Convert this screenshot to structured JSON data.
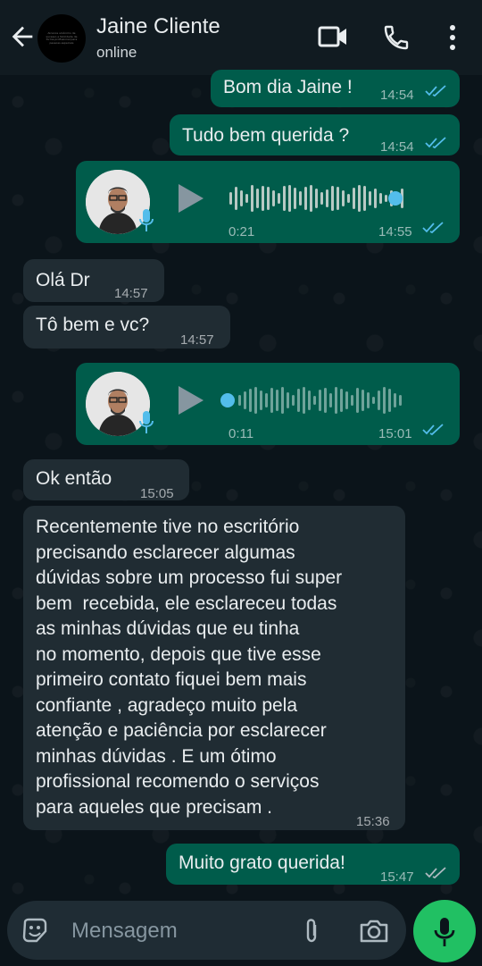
{
  "header": {
    "contact_name": "Jaine Cliente",
    "status": "online",
    "avatar_fineprint": "Alcance sinônimo de sucesso e felicidade de forma profissional para pessoas especiais",
    "icons": [
      "back-arrow-icon",
      "video-call-icon",
      "phone-icon",
      "more-vert-icon"
    ]
  },
  "messages": [
    {
      "type": "text",
      "direction": "out",
      "text": "Bom dia Jaine !",
      "time": "14:54",
      "status": "read"
    },
    {
      "type": "text",
      "direction": "out",
      "text": "Tudo bem querida ?",
      "time": "14:54",
      "status": "read"
    },
    {
      "type": "audio",
      "direction": "out",
      "duration": "0:21",
      "time": "14:55",
      "status": "read",
      "progress": 0.95
    },
    {
      "type": "text",
      "direction": "in",
      "text": "Olá Dr",
      "time": "14:57"
    },
    {
      "type": "text",
      "direction": "in",
      "text": "Tô bem e vc?",
      "time": "14:57"
    },
    {
      "type": "audio",
      "direction": "out",
      "duration": "0:11",
      "time": "15:01",
      "status": "read",
      "progress": 0.0
    },
    {
      "type": "text",
      "direction": "in",
      "text": "Ok então",
      "time": "15:05"
    },
    {
      "type": "text",
      "direction": "in",
      "lines": [
        "Recentemente tive no escritório",
        "precisando esclarecer algumas",
        "dúvidas sobre um processo fui super",
        "bem  recebida, ele esclareceu todas",
        "as minhas dúvidas que eu tinha",
        "no momento, depois que tive esse",
        "primeiro contato fiquei bem mais",
        "confiante , agradeço muito pela",
        "atenção e paciência por esclarecer",
        "minhas dúvidas . E um ótimo",
        "profissional recomendo o serviços",
        "para aqueles que precisam ."
      ],
      "time": "15:36"
    },
    {
      "type": "text",
      "direction": "out",
      "text": "Muito grato querida!",
      "time": "15:47",
      "status": "delivered"
    }
  ],
  "composer": {
    "placeholder": "Mensagem",
    "icons": [
      "emoji-icon",
      "attach-icon",
      "camera-icon",
      "mic-icon"
    ]
  },
  "colors": {
    "outgoing_bubble": "#005c4b",
    "incoming_bubble": "#202c33",
    "read_ticks": "#53bdeb",
    "accent_green": "#21c063"
  }
}
